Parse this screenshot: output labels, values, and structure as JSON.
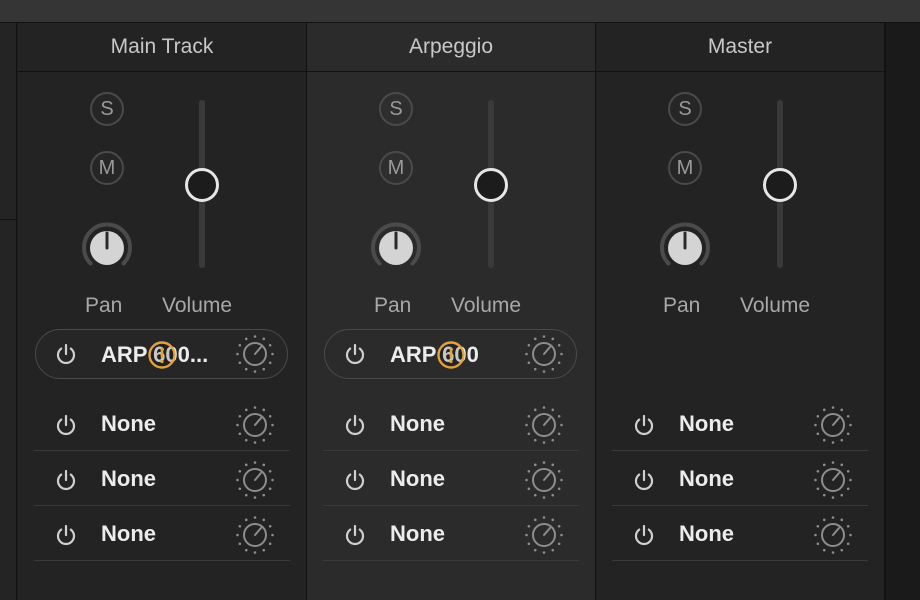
{
  "mixer": {
    "channels": [
      {
        "title": "Main Track",
        "solo": "S",
        "mute": "M",
        "pan_label": "Pan",
        "volume_label": "Volume",
        "pan_value": 0,
        "volume_level": 0.5,
        "selected": false,
        "plugin": {
          "name": "ARP 600...",
          "warning": true
        },
        "slots": [
          "None",
          "None",
          "None"
        ]
      },
      {
        "title": "Arpeggio",
        "solo": "S",
        "mute": "M",
        "pan_label": "Pan",
        "volume_label": "Volume",
        "pan_value": 0,
        "volume_level": 0.5,
        "selected": true,
        "plugin": {
          "name": "ARP 600",
          "warning": true
        },
        "slots": [
          "None",
          "None",
          "None"
        ]
      },
      {
        "title": "Master",
        "solo": "S",
        "mute": "M",
        "pan_label": "Pan",
        "volume_label": "Volume",
        "pan_value": 0,
        "volume_level": 0.5,
        "selected": false,
        "plugin": null,
        "slots": [
          "None",
          "None",
          "None"
        ]
      }
    ]
  },
  "colors": {
    "warning_accent": "#e3a33a",
    "fader_thumb_ring": "#e6e6e6",
    "panel_bg": "#232323",
    "selected_panel_bg": "#2b2b2b"
  },
  "icons": {
    "power": "power-icon",
    "dial": "dial-icon",
    "warning": "warning-icon"
  }
}
